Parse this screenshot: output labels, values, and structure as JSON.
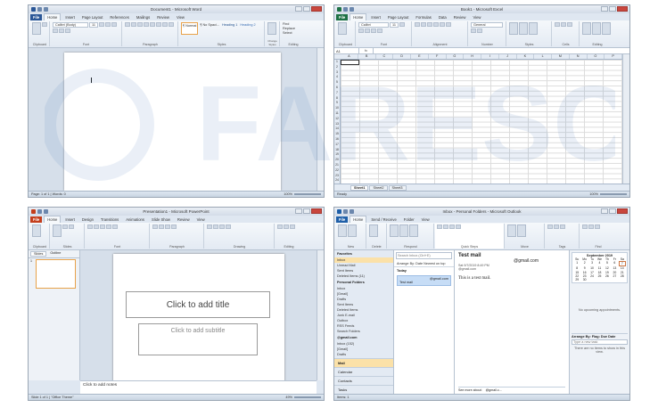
{
  "watermark": "FARESCD",
  "word": {
    "title": "Document1 - Microsoft Word",
    "tabs": [
      "File",
      "Home",
      "Insert",
      "Page Layout",
      "References",
      "Mailings",
      "Review",
      "View"
    ],
    "font": "Calibri (Body)",
    "size": "11",
    "styles": [
      "¶ Normal",
      "¶ No Spaci...",
      "Heading 1",
      "Heading 2"
    ],
    "groups": [
      "Clipboard",
      "Font",
      "Paragraph",
      "Styles",
      "Editing"
    ],
    "editing": [
      "Find",
      "Replace",
      "Select"
    ],
    "change_styles": "Change Styles",
    "status_left": "Page: 1 of 1  |  Words: 0",
    "zoom": "100%"
  },
  "excel": {
    "title": "Book1 - Microsoft Excel",
    "tabs": [
      "File",
      "Home",
      "Insert",
      "Page Layout",
      "Formulas",
      "Data",
      "Review",
      "View"
    ],
    "font": "Calibri",
    "size": "11",
    "number_format": "General",
    "groups": [
      "Clipboard",
      "Font",
      "Alignment",
      "Number",
      "Styles",
      "Cells",
      "Editing"
    ],
    "namebox": "A1",
    "fx": "fx",
    "columns": [
      "A",
      "B",
      "C",
      "D",
      "E",
      "F",
      "G",
      "H",
      "I",
      "J",
      "K",
      "L",
      "M",
      "N",
      "O",
      "P"
    ],
    "rows": [
      "1",
      "2",
      "3",
      "4",
      "5",
      "6",
      "7",
      "8",
      "9",
      "10",
      "11",
      "12",
      "13",
      "14",
      "15",
      "16",
      "17",
      "18",
      "19",
      "20",
      "21",
      "22",
      "23",
      "24",
      "25",
      "26"
    ],
    "sheets": [
      "Sheet1",
      "Sheet2",
      "Sheet3"
    ],
    "status_left": "Ready",
    "zoom": "100%"
  },
  "ppt": {
    "title": "Presentation1 - Microsoft PowerPoint",
    "tabs": [
      "File",
      "Home",
      "Insert",
      "Design",
      "Transitions",
      "Animations",
      "Slide Show",
      "Review",
      "View"
    ],
    "groups": [
      "Clipboard",
      "Slides",
      "Font",
      "Paragraph",
      "Drawing",
      "Editing"
    ],
    "new_slide": "New Slide",
    "slide_tabs": [
      "Slides",
      "Outline"
    ],
    "slide_number": "1",
    "title_placeholder": "Click to add title",
    "subtitle_placeholder": "Click to add subtitle",
    "notes": "Click to add notes",
    "status_left": "Slide 1 of 1  |  \"Office Theme\"",
    "zoom": "49%"
  },
  "outlook": {
    "title": "Inbox - Personal Folders - Microsoft Outlook",
    "tabs": [
      "File",
      "Home",
      "Send / Receive",
      "Folder",
      "View"
    ],
    "groups": [
      "New",
      "Delete",
      "Respond",
      "Quick Steps",
      "Move",
      "Tags",
      "Find"
    ],
    "new_email": "New E-mail",
    "new_items": "New Items",
    "favorites": "Favorites",
    "fav_items": [
      "Inbox",
      "Unread Mail",
      "Sent Items",
      "Deleted Items (11)"
    ],
    "personal": "Personal Folders",
    "folders": [
      "Inbox",
      "[Gmail]",
      "Drafts",
      "Sent Items",
      "Deleted Items",
      "Junk E-mail",
      "Outbox",
      "RSS Feeds",
      "Search Folders"
    ],
    "account": "@gmail.com",
    "account_folders": [
      "Inbox (152)",
      "[Gmail]",
      "Drafts"
    ],
    "nav_bottom": [
      "Mail",
      "Calendar",
      "Contacts",
      "Tasks"
    ],
    "search_placeholder": "Search Inbox (Ctrl+E)",
    "arrange": "Arrange By: Date  Newest on top",
    "group_today": "Today",
    "msg_from": "@gmail.com",
    "msg_subject": "Test mail",
    "read_subject": "Test mail",
    "read_sender": "@gmail.com",
    "read_sent": "Sat 9/7/2019 8:49 PM",
    "read_to": "@gmail.com",
    "read_body": "This is a test mail.",
    "see_more": "See more about:",
    "see_more_addr": "@gmail.c...",
    "cal_month": "September 2019",
    "cal_days": [
      "Su",
      "Mo",
      "Tu",
      "We",
      "Th",
      "Fr",
      "Sa"
    ],
    "cal_dates": [
      "1",
      "2",
      "3",
      "4",
      "5",
      "6",
      "7",
      "8",
      "9",
      "10",
      "11",
      "12",
      "13",
      "14",
      "15",
      "16",
      "17",
      "18",
      "19",
      "20",
      "21",
      "22",
      "23",
      "24",
      "25",
      "26",
      "27",
      "28",
      "29",
      "30"
    ],
    "no_appts": "No upcoming appointments.",
    "arrange_flag": "Arrange By: Flag: Due Date",
    "new_task": "Type a new task",
    "no_tasks": "There are no items to show in this view.",
    "status_left": "Items: 1"
  }
}
